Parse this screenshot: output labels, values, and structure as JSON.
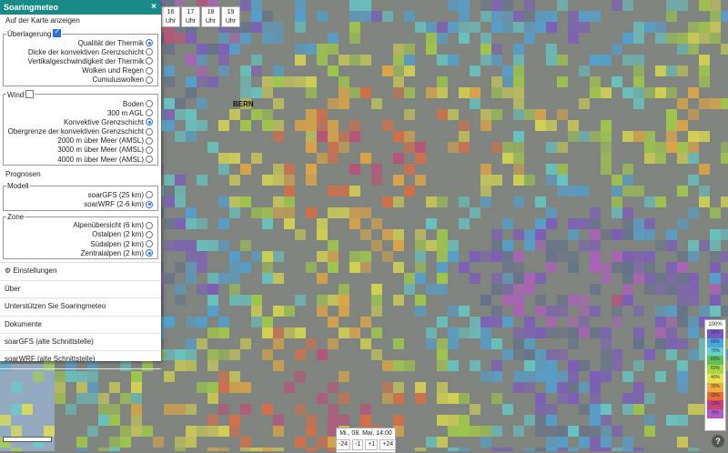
{
  "panel": {
    "title": "Soaringmeteo",
    "close_label": "×",
    "show_on_map": "Auf der Karte anzeigen",
    "overlay": {
      "legend": "Überlagerung",
      "checked": true,
      "options": [
        {
          "label": "Qualität der Thermik",
          "selected": true
        },
        {
          "label": "Dicke der konvektiven Grenzschicht",
          "selected": false
        },
        {
          "label": "Vertikalgeschwindigkeit der Thermik",
          "selected": false
        },
        {
          "label": "Wolken und Regen",
          "selected": false
        },
        {
          "label": "Cumuluswolken",
          "selected": false
        }
      ]
    },
    "wind": {
      "legend": "Wind",
      "checked": false,
      "options": [
        {
          "label": "Boden",
          "selected": false
        },
        {
          "label": "300 m AGL",
          "selected": false
        },
        {
          "label": "Konvektive Grenzschicht",
          "selected": true
        },
        {
          "label": "Obergrenze der konvektiven Grenzschicht",
          "selected": false
        },
        {
          "label": "2000 m über Meer (AMSL)",
          "selected": false
        },
        {
          "label": "3000 m über Meer (AMSL)",
          "selected": false
        },
        {
          "label": "4000 m über Meer (AMSL)",
          "selected": false
        }
      ]
    },
    "forecasts_label": "Prognosen",
    "model": {
      "legend": "Modell",
      "options": [
        {
          "label": "soarGFS (25 km)",
          "selected": false
        },
        {
          "label": "soarWRF (2-6 km)",
          "selected": true
        }
      ]
    },
    "zone": {
      "legend": "Zone",
      "options": [
        {
          "label": "Alpenübersicht (6 km)",
          "selected": false
        },
        {
          "label": "Ostalpen (2 km)",
          "selected": false
        },
        {
          "label": "Südalpen (2 km)",
          "selected": false
        },
        {
          "label": "Zentralalpen (2 km)",
          "selected": true
        }
      ]
    },
    "settings_icon": "gear-icon",
    "settings_label": "Einstellungen",
    "menu": [
      "Über",
      "Unterstützen Sie Soaringmeteo",
      "Dokumente",
      "soarGFS (alte Schnittstelle)",
      "soarWRF (alte Schnittstelle)"
    ]
  },
  "hours": [
    {
      "num": "16",
      "unit": "Uhr"
    },
    {
      "num": "17",
      "unit": "Uhr"
    },
    {
      "num": "18",
      "unit": "Uhr"
    },
    {
      "num": "19",
      "unit": "Uhr"
    }
  ],
  "timebar": {
    "label": "Mi., 08. Mai, 14:00",
    "buttons": [
      "-24",
      "-1",
      "+1",
      "+24"
    ]
  },
  "scale": {
    "title": "100%",
    "cells": [
      {
        "label": "90%",
        "color": "#7b55c6"
      },
      {
        "label": "80%",
        "color": "#4aa6e0"
      },
      {
        "label": "70%",
        "color": "#63d3d0"
      },
      {
        "label": "60%",
        "color": "#5ec25b"
      },
      {
        "label": "50%",
        "color": "#a8d542"
      },
      {
        "label": "40%",
        "color": "#e6e44b"
      },
      {
        "label": "30%",
        "color": "#f1ad3c"
      },
      {
        "label": "20%",
        "color": "#e86a3a"
      },
      {
        "label": "10%",
        "color": "#c9437a"
      },
      {
        "label": "0%",
        "color": "#b35bc2"
      }
    ]
  },
  "help_label": "?",
  "map": {
    "city": "BERN"
  }
}
